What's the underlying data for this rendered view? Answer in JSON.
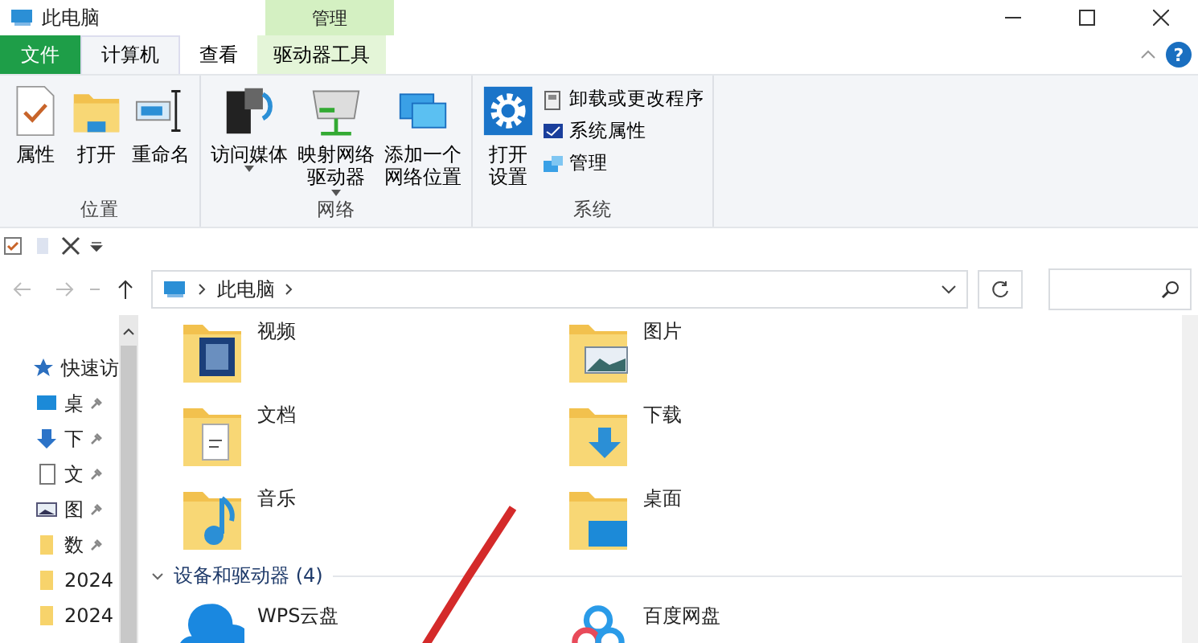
{
  "window": {
    "title": "此电脑",
    "context_tab_header": "管理"
  },
  "tabs": [
    {
      "label": "文件",
      "kind": "file",
      "selected": false
    },
    {
      "label": "计算机",
      "kind": "normal",
      "selected": true
    },
    {
      "label": "查看",
      "kind": "normal",
      "selected": false
    },
    {
      "label": "驱动器工具",
      "kind": "context",
      "selected": false
    }
  ],
  "help_button": {
    "label": "?"
  },
  "ribbon": {
    "groups": [
      {
        "label": "位置",
        "buttons": [
          {
            "label": "属性"
          },
          {
            "label": "打开"
          },
          {
            "label": "重命名"
          }
        ]
      },
      {
        "label": "网络",
        "buttons": [
          {
            "label": "访问媒体",
            "dropdown": true
          },
          {
            "label": "映射网络驱动器",
            "dropdown": true
          },
          {
            "label": "添加一个网络位置",
            "dropdown": false
          }
        ]
      },
      {
        "label": "系统",
        "buttons": [
          {
            "label": "打开设置"
          }
        ],
        "small_buttons": [
          {
            "label": "卸载或更改程序"
          },
          {
            "label": "系统属性"
          },
          {
            "label": "管理"
          }
        ]
      }
    ]
  },
  "address_bar": {
    "path": [
      "此电脑"
    ]
  },
  "sidebar": {
    "items": [
      {
        "label": "快速访"
      },
      {
        "label": "桌",
        "pinned": true
      },
      {
        "label": "下",
        "pinned": true
      },
      {
        "label": "文",
        "pinned": true
      },
      {
        "label": "图",
        "pinned": true
      },
      {
        "label": "数",
        "pinned": true
      },
      {
        "label": "2024"
      },
      {
        "label": "2024"
      }
    ]
  },
  "folders": [
    {
      "name": "视频"
    },
    {
      "name": "图片"
    },
    {
      "name": "文档"
    },
    {
      "name": "下载"
    },
    {
      "name": "音乐"
    },
    {
      "name": "桌面"
    }
  ],
  "devices": {
    "heading": "设备和驱动器 (4)",
    "items": [
      {
        "name": "WPS云盘"
      },
      {
        "name": "百度网盘"
      }
    ]
  }
}
